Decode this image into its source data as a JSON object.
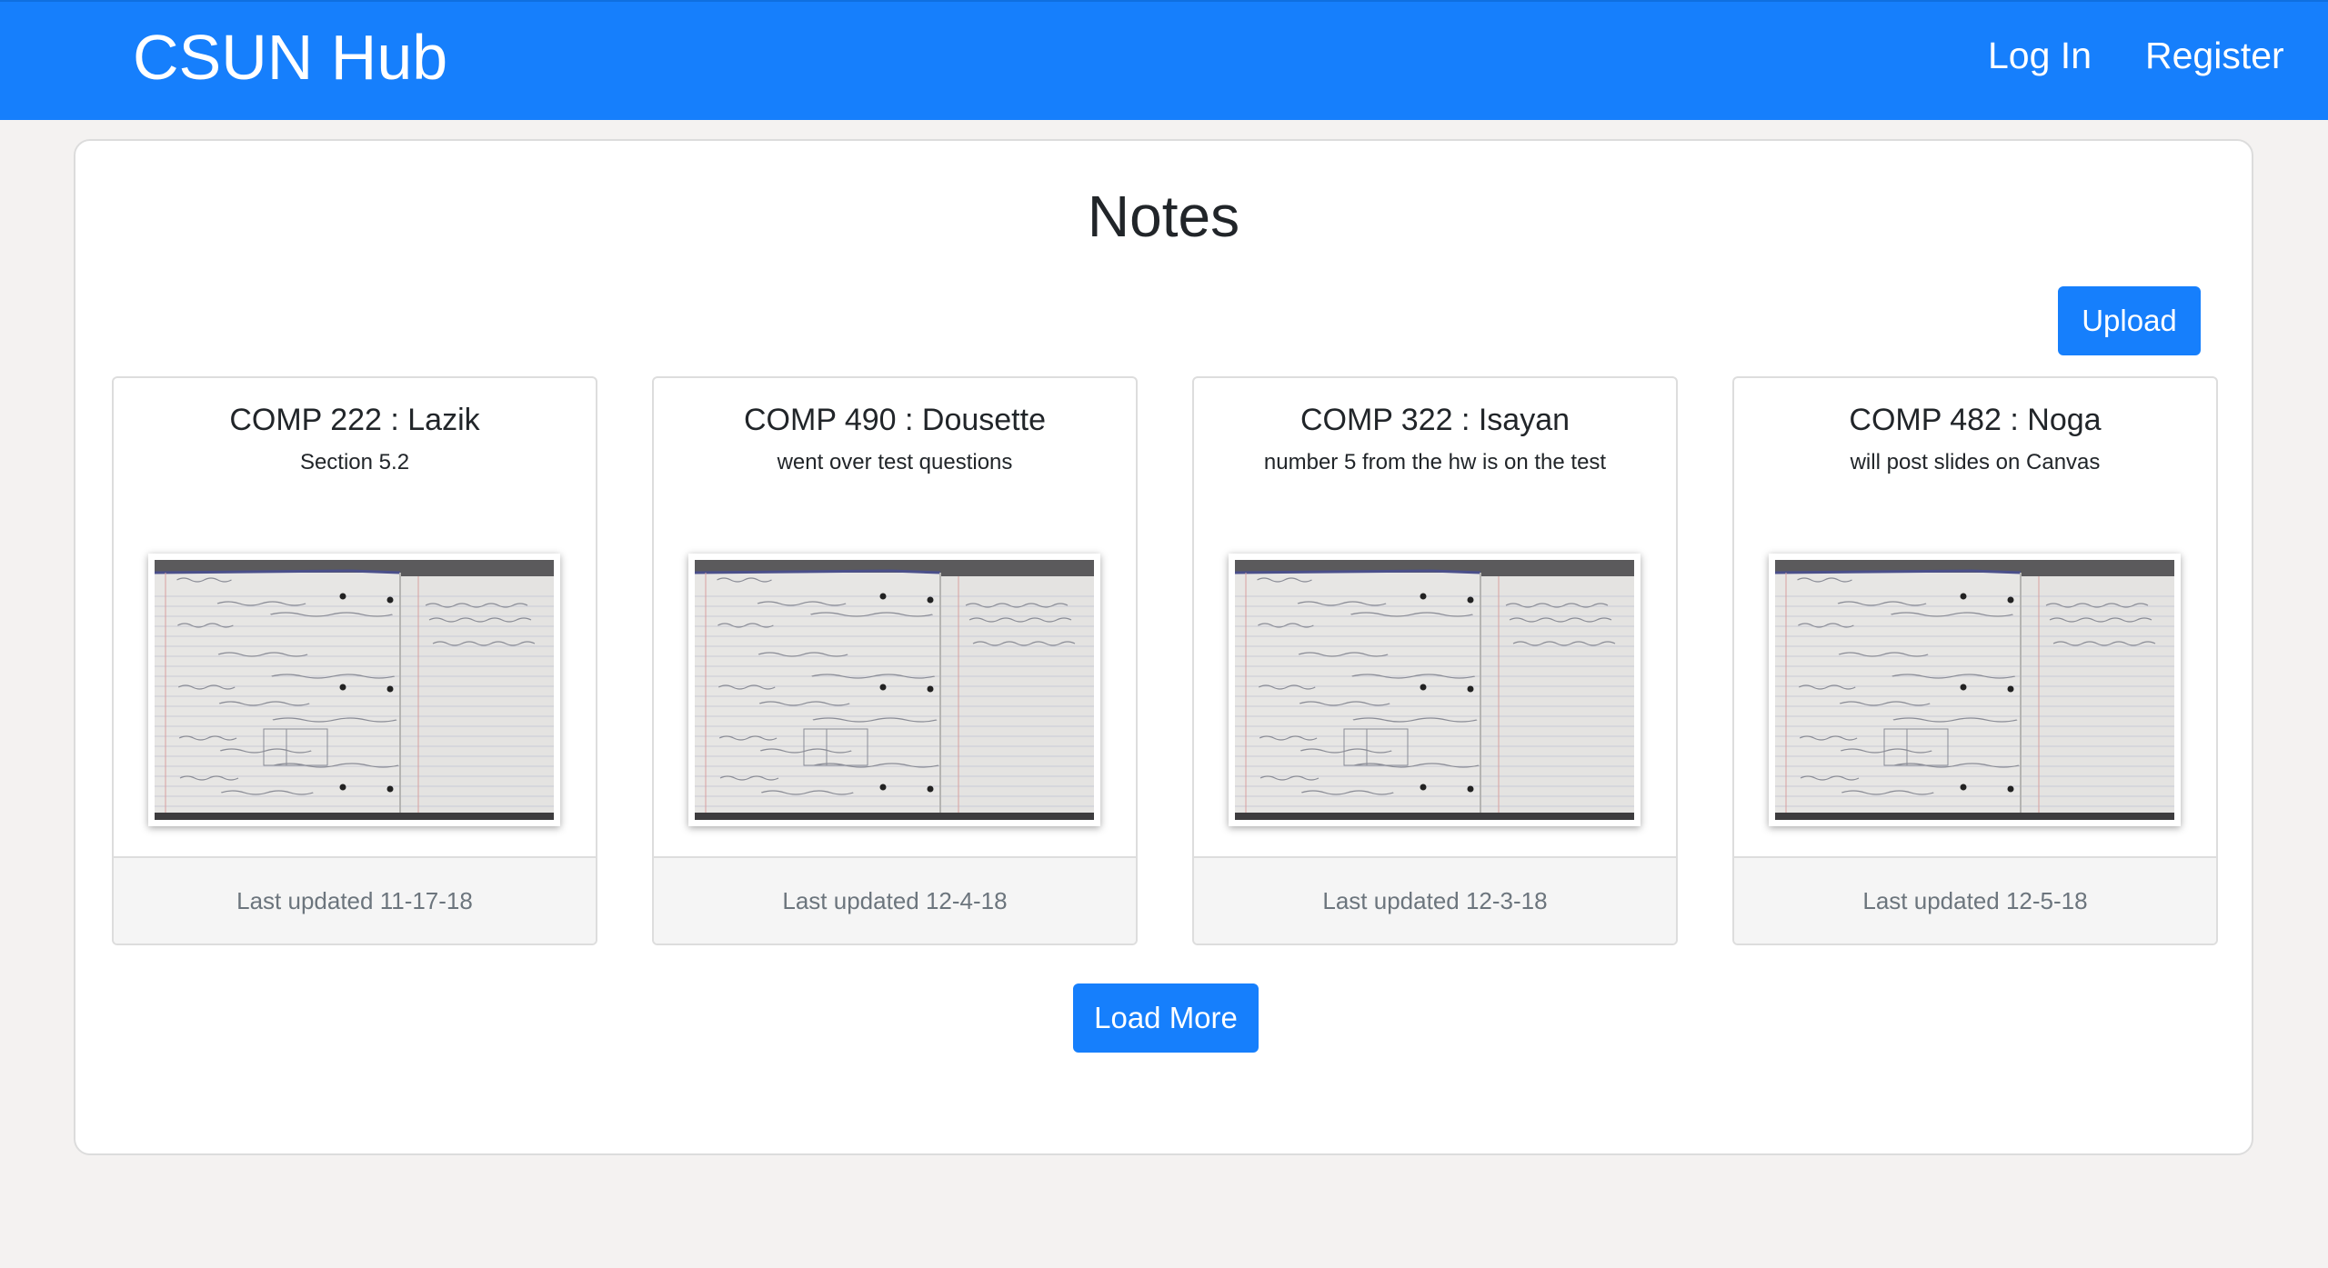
{
  "navbar": {
    "brand": "CSUN Hub",
    "login_label": "Log In",
    "register_label": "Register",
    "color": "#167ffc"
  },
  "main": {
    "title": "Notes",
    "upload_label": "Upload",
    "load_more_label": "Load More",
    "cards": [
      {
        "title": "COMP 222 : Lazik",
        "text": "Section 5.2",
        "footer": "Last updated 11-17-18",
        "image": "notebook-photo"
      },
      {
        "title": "COMP 490 : Dousette",
        "text": "went over test questions",
        "footer": "Last updated 12-4-18",
        "image": "notebook-photo"
      },
      {
        "title": "COMP 322 : Isayan",
        "text": "number 5 from the hw is on the test",
        "footer": "Last updated 12-3-18",
        "image": "notebook-photo"
      },
      {
        "title": "COMP 482 : Noga",
        "text": "will post slides on Canvas",
        "footer": "Last updated 12-5-18",
        "image": "notebook-photo"
      }
    ]
  }
}
